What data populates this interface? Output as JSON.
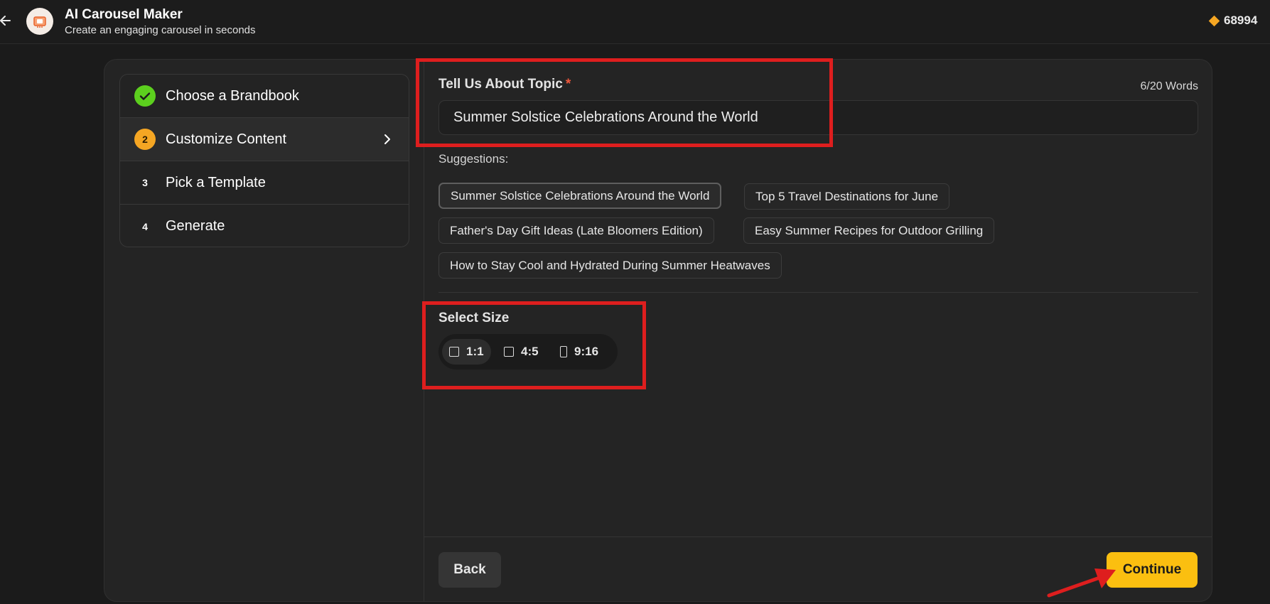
{
  "header": {
    "title": "AI Carousel Maker",
    "subtitle": "Create an engaging carousel in seconds",
    "credits": "68994"
  },
  "steps": [
    {
      "number": "1",
      "label": "Choose a Brandbook",
      "status": "done"
    },
    {
      "number": "2",
      "label": "Customize Content",
      "status": "active"
    },
    {
      "number": "3",
      "label": "Pick a Template",
      "status": "pending"
    },
    {
      "number": "4",
      "label": "Generate",
      "status": "pending"
    }
  ],
  "topic": {
    "label": "Tell Us About Topic",
    "required_marker": "*",
    "word_count": "6/20 Words",
    "value": "Summer Solstice Celebrations Around the World"
  },
  "suggestions": {
    "label": "Suggestions:",
    "items": [
      "Summer Solstice Celebrations Around the World",
      "Top 5 Travel Destinations for June",
      "Father's Day Gift Ideas (Late Bloomers Edition)",
      "Easy Summer Recipes for Outdoor Grilling",
      "How to Stay Cool and Hydrated During Summer Heatwaves"
    ],
    "selected_index": 0
  },
  "size": {
    "label": "Select Size",
    "options": [
      "1:1",
      "4:5",
      "9:16"
    ],
    "selected": "1:1"
  },
  "footer": {
    "back_label": "Back",
    "continue_label": "Continue"
  },
  "colors": {
    "accent": "#fbbf10",
    "done": "#5ccf1e",
    "annotation": "#de1e1e"
  }
}
